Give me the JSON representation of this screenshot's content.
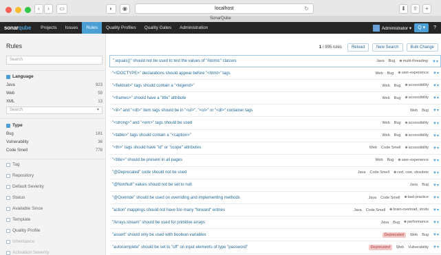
{
  "browser": {
    "back_icon": "chevron-left-icon",
    "forward_icon": "chevron-right-icon",
    "sidebar_icon": "sidebar-icon",
    "url": "localhost",
    "tab_title": "SonarQube",
    "reload_glyph": "↻",
    "shield_glyph": "◐",
    "download_glyph": "⬇",
    "share_glyph": "⇪",
    "plus_glyph": "+"
  },
  "topnav": {
    "logo_text": "sonar",
    "logo_q": "qube",
    "items": [
      "Projects",
      "Issues",
      "Rules",
      "Quality Profiles",
      "Quality Gates",
      "Administration"
    ],
    "active": "Rules",
    "admin_label": "Administrator ▾",
    "search_label": "Q ▾",
    "help_label": "?"
  },
  "sidebar": {
    "title": "Rules",
    "search_placeholder": "Search",
    "language": {
      "heading": "Language",
      "rows": [
        {
          "name": "Java",
          "count": "923"
        },
        {
          "name": "Web",
          "count": "59"
        },
        {
          "name": "XML",
          "count": "13"
        }
      ],
      "search_placeholder": "Search"
    },
    "type": {
      "heading": "Type",
      "rows": [
        {
          "name": "Bug",
          "count": "181"
        },
        {
          "name": "Vulnerability",
          "count": "36"
        },
        {
          "name": "Code Smell",
          "count": "778"
        }
      ]
    },
    "closed_facets": [
      "Tag",
      "Repository",
      "Default Severity",
      "Status",
      "Available Since",
      "Template",
      "Quality Profile"
    ],
    "disabled_facets": [
      "Inheritance",
      "Activation Severity"
    ]
  },
  "toolbar": {
    "count_current": "1",
    "count_rest": " / 995 rules",
    "reload": "Reload",
    "new_search": "New Search",
    "bulk_change": "Bulk Change"
  },
  "rules": [
    {
      "title": "\".equals()\" should not be used to test the values of \"Atomic\" classes",
      "meta": [
        "Java",
        "Bug"
      ],
      "tags": "multi-threading",
      "deprecated": false
    },
    {
      "title": "\"<!DOCTYPE>\" declarations should appear before \"<html>\" tags",
      "meta": [
        "Web",
        "Bug"
      ],
      "tags": "user-experience",
      "deprecated": false
    },
    {
      "title": "\"<fieldset>\" tags should contain a \"<legend>\"",
      "meta": [
        "Web",
        "Bug"
      ],
      "tags": "accessibility",
      "deprecated": false
    },
    {
      "title": "\"<frames>\" should have a \"title\" attribute",
      "meta": [
        "Web",
        "Bug"
      ],
      "tags": "accessibility",
      "deprecated": false
    },
    {
      "title": "\"<li>\" and \"<dt>\" item tags should be in \"<ul>\", \"<ol>\" or \"<dl>\" container tags",
      "meta": [
        "Web",
        "Bug"
      ],
      "tags": "",
      "deprecated": false
    },
    {
      "title": "\"<strong>\" and \"<em>\" tags should be used",
      "meta": [
        "Web",
        "Bug"
      ],
      "tags": "accessibility",
      "deprecated": false
    },
    {
      "title": "\"<table>\" tags should contain a \"<caption>\"",
      "meta": [
        "Web",
        "Bug"
      ],
      "tags": "accessibility",
      "deprecated": false
    },
    {
      "title": "\"<th>\" tags should have \"id\" or \"scope\" attributes",
      "meta": [
        "Web",
        "Code Smell"
      ],
      "tags": "accessibility",
      "deprecated": false
    },
    {
      "title": "\"<title>\" should be present in all pages",
      "meta": [
        "Web",
        "Bug"
      ],
      "tags": "user-experience",
      "deprecated": false
    },
    {
      "title": "\"@Deprecated\" code should not be used",
      "meta": [
        "Java",
        "Code Smell"
      ],
      "tags": "cert, cwe, obsolete",
      "deprecated": false
    },
    {
      "title": "\"@NonNull\" values should not be set to null",
      "meta": [
        "Java",
        "Bug"
      ],
      "tags": "",
      "deprecated": false
    },
    {
      "title": "\"@Override\" should be used on overriding and implementing methods",
      "meta": [
        "Java",
        "Code Smell"
      ],
      "tags": "bad-practice",
      "deprecated": false
    },
    {
      "title": "\"action\" mappings should not have too many \"forward\" entries",
      "meta": [
        "Java",
        "Code Smell"
      ],
      "tags": "brain-overload, struts",
      "deprecated": false
    },
    {
      "title": "\"Arrays.stream\" should be used for primitive arrays",
      "meta": [
        "Java",
        "Bug"
      ],
      "tags": "performance",
      "deprecated": false
    },
    {
      "title": "\"assert\" should only be used with boolean variables",
      "meta": [
        "Deprecated",
        "Web",
        "Bug"
      ],
      "tags": "",
      "deprecated": true
    },
    {
      "title": "\"autocomplete\" should be set to \"off\" on input elements of type \"password\"",
      "meta": [
        "Deprecated",
        "Web",
        "Vulnerability"
      ],
      "tags": "",
      "deprecated": true
    }
  ],
  "colors": {
    "accent": "#4b9fd5",
    "nav": "#262626",
    "link": "#236a97"
  }
}
